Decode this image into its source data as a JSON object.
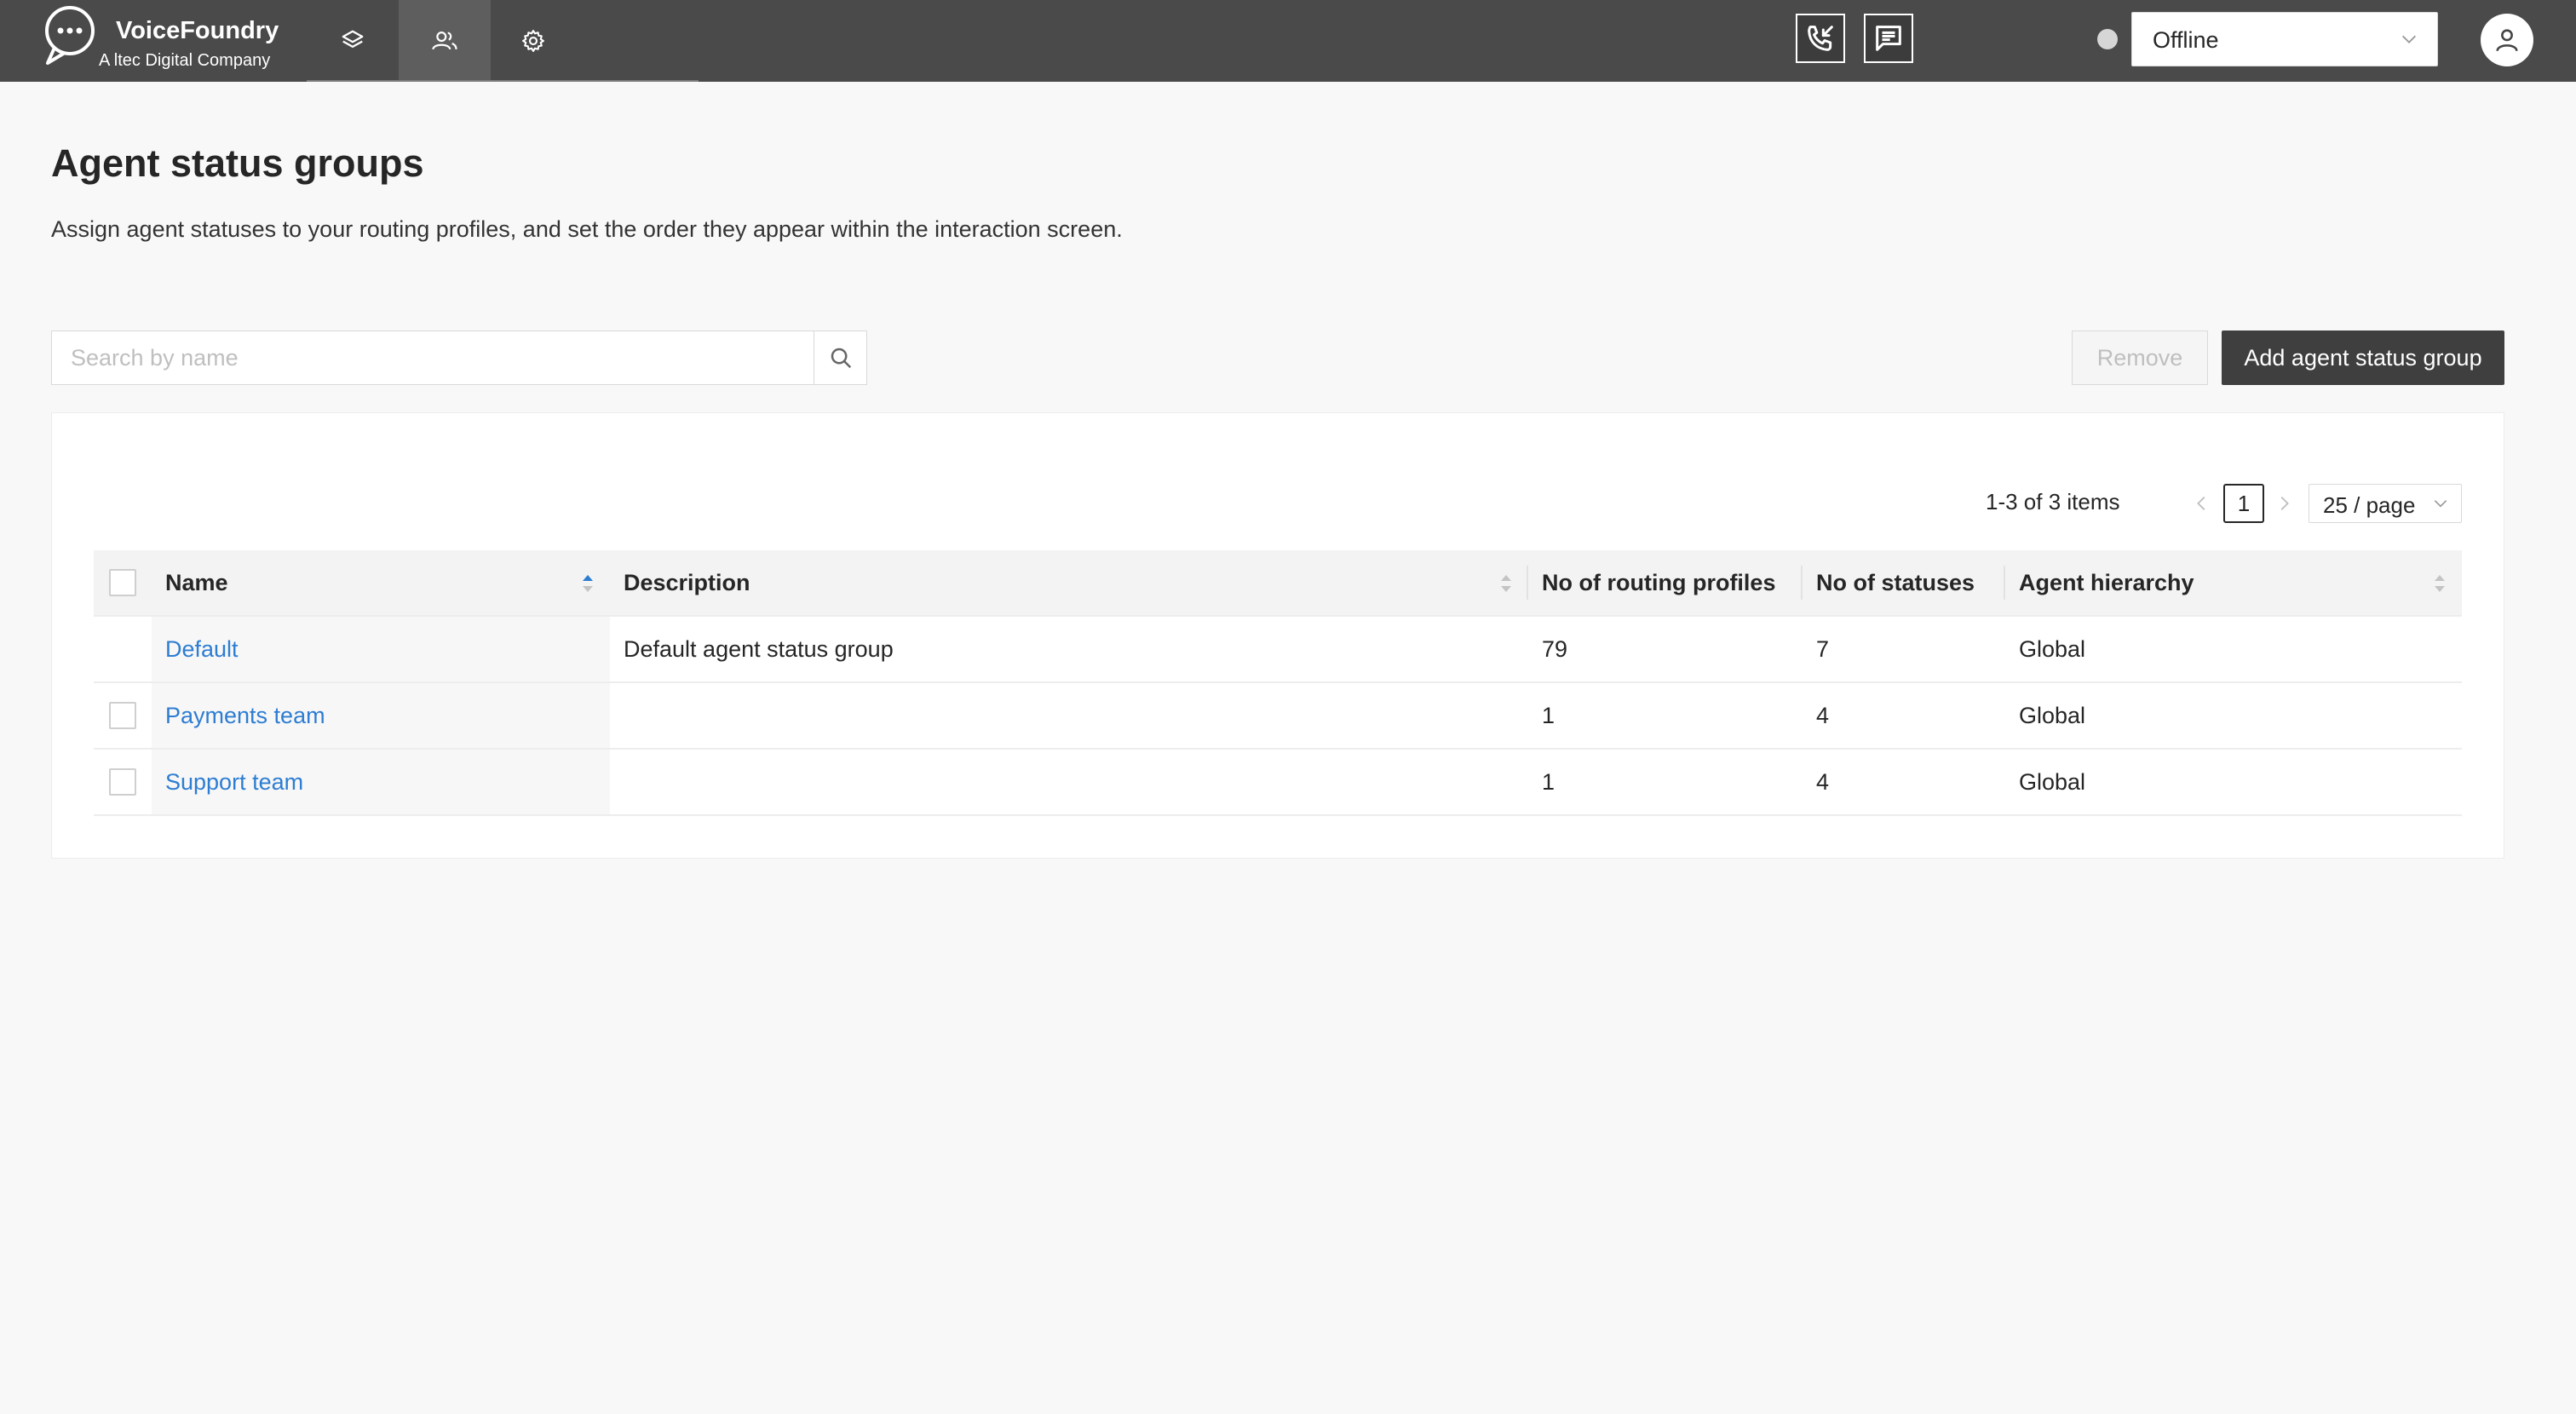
{
  "brand": {
    "name": "VoiceFoundry",
    "tagline": "A ltec Digital Company"
  },
  "nav": {
    "items": [
      {
        "icon": "layers-icon"
      },
      {
        "icon": "users-icon",
        "active": true
      },
      {
        "icon": "gear-icon"
      }
    ]
  },
  "toolbar": {
    "call_icon": "incoming-call-icon",
    "chat_icon": "chat-icon"
  },
  "agent_status": {
    "value": "Offline",
    "dot_color": "#d6d6d6"
  },
  "page": {
    "title": "Agent status groups",
    "description": "Assign agent statuses to your routing profiles, and set the order they appear within the interaction screen."
  },
  "search": {
    "placeholder": "Search by name",
    "value": ""
  },
  "actions": {
    "remove_label": "Remove",
    "add_label": "Add agent status group"
  },
  "pagination": {
    "total_text": "1-3 of 3 items",
    "current_page": "1",
    "page_size": "25 / page"
  },
  "table": {
    "columns": {
      "name": "Name",
      "description": "Description",
      "routing_profiles": "No of routing profiles",
      "statuses": "No of statuses",
      "hierarchy": "Agent hierarchy"
    },
    "rows": [
      {
        "name": "Default",
        "description": "Default agent status group",
        "routing_profiles": "79",
        "statuses": "7",
        "hierarchy": "Global",
        "selectable": false
      },
      {
        "name": "Payments team",
        "description": "",
        "routing_profiles": "1",
        "statuses": "4",
        "hierarchy": "Global",
        "selectable": true
      },
      {
        "name": "Support team",
        "description": "",
        "routing_profiles": "1",
        "statuses": "4",
        "hierarchy": "Global",
        "selectable": true
      }
    ]
  },
  "colors": {
    "topbar": "#4a4a4a",
    "link": "#2d7dd2",
    "primary_button": "#3f3f3f"
  }
}
